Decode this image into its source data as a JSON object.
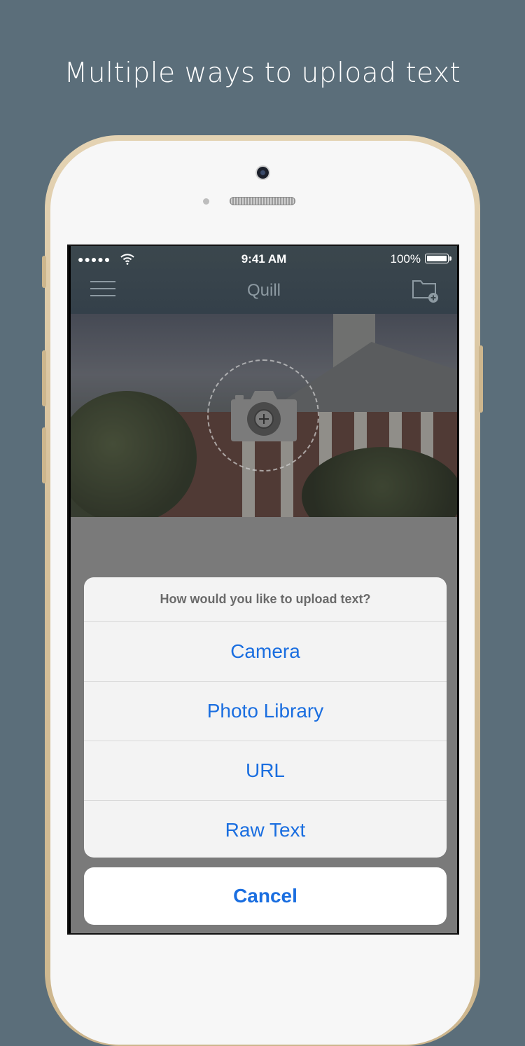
{
  "headline": "Multiple ways to upload text",
  "status": {
    "signal": "●●●●●",
    "time": "9:41 AM",
    "battery": "100%"
  },
  "navbar": {
    "title": "Quill",
    "menu_icon": "hamburger-icon",
    "folder_icon": "folder-add-icon"
  },
  "hero": {
    "icon": "camera-add-icon"
  },
  "action_sheet": {
    "title": "How would you like to upload text?",
    "options": [
      "Camera",
      "Photo Library",
      "URL",
      "Raw Text"
    ],
    "cancel": "Cancel"
  },
  "colors": {
    "background": "#5b6e7a",
    "accent": "#1a6ee0",
    "navbar": "#3b474d"
  }
}
